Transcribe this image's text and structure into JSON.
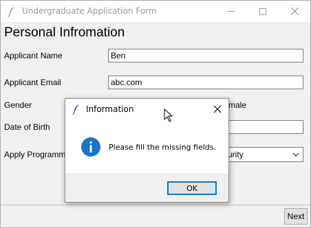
{
  "window": {
    "title": "Undergraduate Application Form",
    "controls": [
      "minimize",
      "maximize",
      "close"
    ]
  },
  "form": {
    "heading": "Personal Infromation",
    "fields": {
      "name_label": "Applicant Name",
      "name_value": "Ben",
      "email_label": "Applicant Email",
      "email_value": "abc.com",
      "gender_label": "Gender",
      "gender_partial_text": "male",
      "dob_label": "Date of Birth",
      "dob_value": "",
      "program_label": "Apply Programm",
      "program_value_partial": "urity"
    },
    "next_label": "Next"
  },
  "dialog": {
    "title": "Information",
    "message": "Please fill the missing fields.",
    "ok_label": "OK",
    "icon": "info-icon"
  },
  "colors": {
    "accent": "#0078d7",
    "info_icon_bg": "#1a73c9",
    "feather_icon": "#1e3a8a"
  }
}
